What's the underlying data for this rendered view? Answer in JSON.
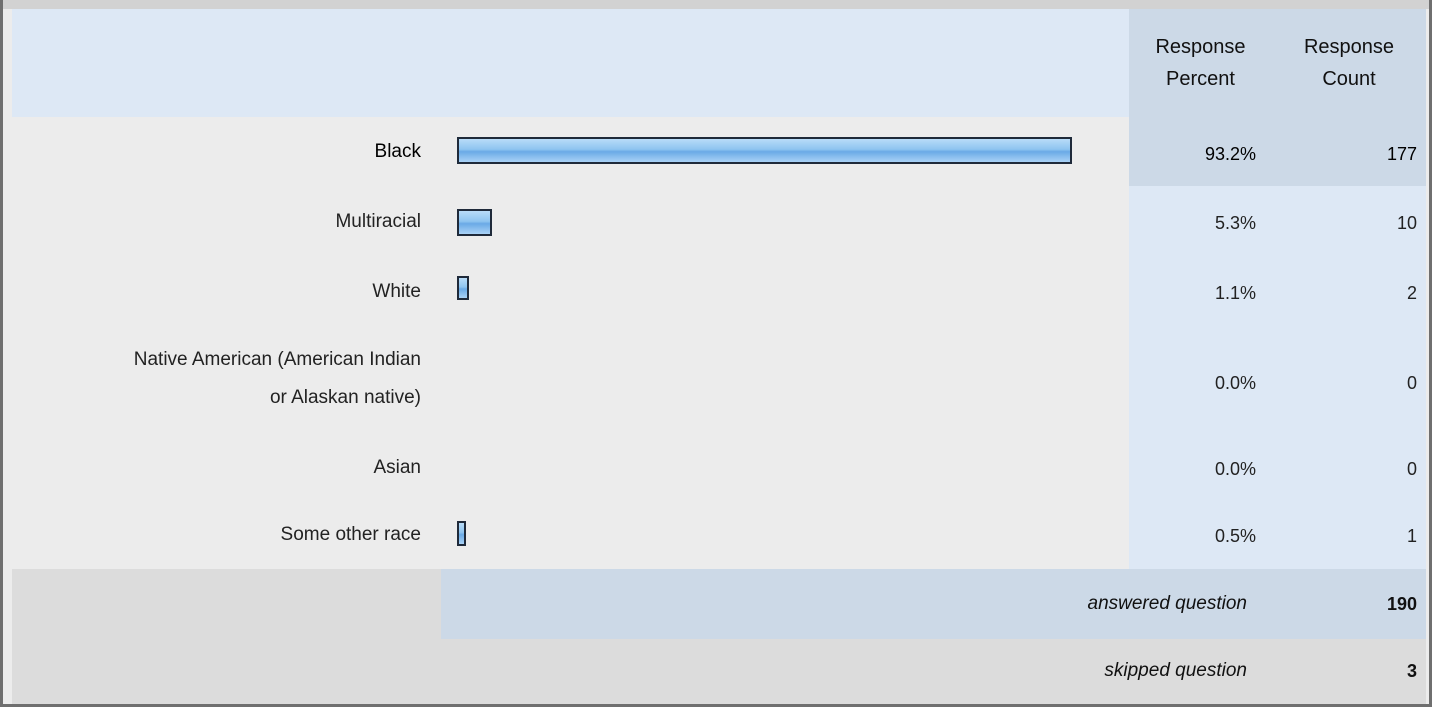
{
  "header": {
    "response_percent": "Response Percent",
    "response_count": "Response Count"
  },
  "chart_data": {
    "type": "bar",
    "orientation": "horizontal",
    "categories": [
      "Black",
      "Multiracial",
      "White",
      "Native American (American Indian or Alaskan native)",
      "Asian",
      "Some other race"
    ],
    "values": [
      93.2,
      5.3,
      1.1,
      0.0,
      0.0,
      0.5
    ],
    "percent_labels": [
      "93.2%",
      "5.3%",
      "1.1%",
      "0.0%",
      "0.0%",
      "0.5%"
    ],
    "counts": [
      "177",
      "10",
      "2",
      "0",
      "0",
      "1"
    ],
    "xlim": [
      0,
      100
    ]
  },
  "rows": [
    {
      "label": "Black",
      "pct": "93.2%",
      "cnt": "177"
    },
    {
      "label": "Multiracial",
      "pct": "5.3%",
      "cnt": "10"
    },
    {
      "label": "White",
      "pct": "1.1%",
      "cnt": "2"
    },
    {
      "label_line1": "Native American (American Indian",
      "label_line2": "or Alaskan native)",
      "pct": "0.0%",
      "cnt": "0"
    },
    {
      "label": "Asian",
      "pct": "0.0%",
      "cnt": "0"
    },
    {
      "label": "Some other race",
      "pct": "0.5%",
      "cnt": "1"
    }
  ],
  "footer": {
    "answered_label": "answered question",
    "answered_value": "190",
    "skipped_label": "skipped question",
    "skipped_value": "3"
  },
  "colors": {
    "bar_fill": "#8ec4f0",
    "bar_border": "#1f2a3a",
    "header_bg": "#dde8f5",
    "highlight_bg": "#ccd9e7"
  }
}
